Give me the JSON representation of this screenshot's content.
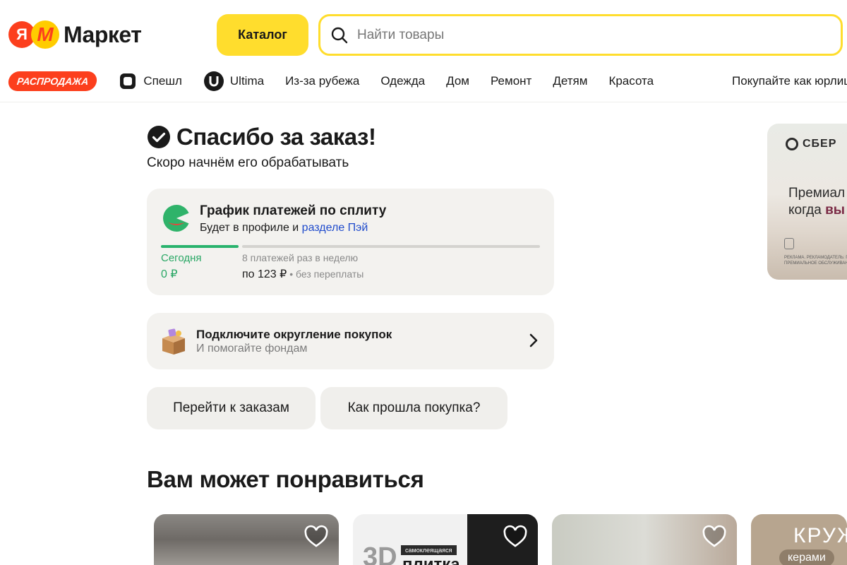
{
  "header": {
    "logo_ya": "Я",
    "logo_m": "М",
    "logo_text": "Маркет",
    "catalog_label": "Каталог",
    "search_placeholder": "Найти товары"
  },
  "nav": {
    "sale": "РАСПРОДАЖА",
    "items": [
      {
        "label": "Спешл",
        "icon": "special-icon"
      },
      {
        "label": "Ultima",
        "icon": "ultima-icon"
      },
      {
        "label": "Из-за рубежа"
      },
      {
        "label": "Одежда"
      },
      {
        "label": "Дом"
      },
      {
        "label": "Ремонт"
      },
      {
        "label": "Детям"
      },
      {
        "label": "Красота"
      }
    ],
    "business": "Покупайте как юрлицо"
  },
  "order": {
    "title": "Спасибо за заказ!",
    "subtitle": "Скоро начнём его обрабатывать"
  },
  "split": {
    "title": "График платежей по сплиту",
    "subtitle_prefix": "Будет в профиле и ",
    "subtitle_link": "разделе Пэй",
    "today_label": "Сегодня",
    "today_value": "0 ₽",
    "schedule_label": "8 платежей раз в неделю",
    "schedule_value": "по 123 ₽",
    "schedule_note": " • без переплаты",
    "colors": {
      "accent": "#29b36d",
      "link": "#1f4bcc"
    }
  },
  "roundup": {
    "title": "Подключите округление покупок",
    "subtitle": "И помогайте фондам"
  },
  "actions": {
    "orders": "Перейти к заказам",
    "review": "Как прошла покупка?"
  },
  "recommendations": {
    "title": "Вам может понравиться",
    "products": [
      {
        "name": "product-1"
      },
      {
        "name": "product-2",
        "label_3d": "3D",
        "badge": "самоклеящаяся",
        "word": "плитка"
      },
      {
        "name": "product-3"
      },
      {
        "name": "product-4",
        "title": "КРУЖ",
        "badge": "керами"
      }
    ]
  },
  "ad": {
    "brand": "СБЕР",
    "line1": "Премиал",
    "line2_prefix": "когда ",
    "line2_accent": "вы",
    "fine_print": "РЕКЛАМА. РЕКЛАМОДАТЕЛЬ: ПАО СБ ПРЕМИАЛЬНОЕ ОБСЛУЖИВАНИЕ — Р"
  },
  "colors": {
    "brand_yellow": "#ffdd2d",
    "brand_red": "#fc3f1d",
    "card_bg": "#f3f2ef"
  }
}
